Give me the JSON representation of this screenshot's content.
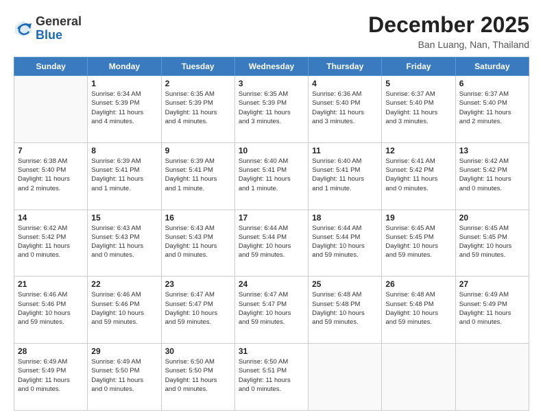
{
  "header": {
    "logo_general": "General",
    "logo_blue": "Blue",
    "month_title": "December 2025",
    "location": "Ban Luang, Nan, Thailand"
  },
  "days_of_week": [
    "Sunday",
    "Monday",
    "Tuesday",
    "Wednesday",
    "Thursday",
    "Friday",
    "Saturday"
  ],
  "weeks": [
    [
      {
        "day": "",
        "info": ""
      },
      {
        "day": "1",
        "info": "Sunrise: 6:34 AM\nSunset: 5:39 PM\nDaylight: 11 hours\nand 4 minutes."
      },
      {
        "day": "2",
        "info": "Sunrise: 6:35 AM\nSunset: 5:39 PM\nDaylight: 11 hours\nand 4 minutes."
      },
      {
        "day": "3",
        "info": "Sunrise: 6:35 AM\nSunset: 5:39 PM\nDaylight: 11 hours\nand 3 minutes."
      },
      {
        "day": "4",
        "info": "Sunrise: 6:36 AM\nSunset: 5:40 PM\nDaylight: 11 hours\nand 3 minutes."
      },
      {
        "day": "5",
        "info": "Sunrise: 6:37 AM\nSunset: 5:40 PM\nDaylight: 11 hours\nand 3 minutes."
      },
      {
        "day": "6",
        "info": "Sunrise: 6:37 AM\nSunset: 5:40 PM\nDaylight: 11 hours\nand 2 minutes."
      }
    ],
    [
      {
        "day": "7",
        "info": "Sunrise: 6:38 AM\nSunset: 5:40 PM\nDaylight: 11 hours\nand 2 minutes."
      },
      {
        "day": "8",
        "info": "Sunrise: 6:39 AM\nSunset: 5:41 PM\nDaylight: 11 hours\nand 1 minute."
      },
      {
        "day": "9",
        "info": "Sunrise: 6:39 AM\nSunset: 5:41 PM\nDaylight: 11 hours\nand 1 minute."
      },
      {
        "day": "10",
        "info": "Sunrise: 6:40 AM\nSunset: 5:41 PM\nDaylight: 11 hours\nand 1 minute."
      },
      {
        "day": "11",
        "info": "Sunrise: 6:40 AM\nSunset: 5:41 PM\nDaylight: 11 hours\nand 1 minute."
      },
      {
        "day": "12",
        "info": "Sunrise: 6:41 AM\nSunset: 5:42 PM\nDaylight: 11 hours\nand 0 minutes."
      },
      {
        "day": "13",
        "info": "Sunrise: 6:42 AM\nSunset: 5:42 PM\nDaylight: 11 hours\nand 0 minutes."
      }
    ],
    [
      {
        "day": "14",
        "info": "Sunrise: 6:42 AM\nSunset: 5:42 PM\nDaylight: 11 hours\nand 0 minutes."
      },
      {
        "day": "15",
        "info": "Sunrise: 6:43 AM\nSunset: 5:43 PM\nDaylight: 11 hours\nand 0 minutes."
      },
      {
        "day": "16",
        "info": "Sunrise: 6:43 AM\nSunset: 5:43 PM\nDaylight: 11 hours\nand 0 minutes."
      },
      {
        "day": "17",
        "info": "Sunrise: 6:44 AM\nSunset: 5:44 PM\nDaylight: 10 hours\nand 59 minutes."
      },
      {
        "day": "18",
        "info": "Sunrise: 6:44 AM\nSunset: 5:44 PM\nDaylight: 10 hours\nand 59 minutes."
      },
      {
        "day": "19",
        "info": "Sunrise: 6:45 AM\nSunset: 5:45 PM\nDaylight: 10 hours\nand 59 minutes."
      },
      {
        "day": "20",
        "info": "Sunrise: 6:45 AM\nSunset: 5:45 PM\nDaylight: 10 hours\nand 59 minutes."
      }
    ],
    [
      {
        "day": "21",
        "info": "Sunrise: 6:46 AM\nSunset: 5:46 PM\nDaylight: 10 hours\nand 59 minutes."
      },
      {
        "day": "22",
        "info": "Sunrise: 6:46 AM\nSunset: 5:46 PM\nDaylight: 10 hours\nand 59 minutes."
      },
      {
        "day": "23",
        "info": "Sunrise: 6:47 AM\nSunset: 5:47 PM\nDaylight: 10 hours\nand 59 minutes."
      },
      {
        "day": "24",
        "info": "Sunrise: 6:47 AM\nSunset: 5:47 PM\nDaylight: 10 hours\nand 59 minutes."
      },
      {
        "day": "25",
        "info": "Sunrise: 6:48 AM\nSunset: 5:48 PM\nDaylight: 10 hours\nand 59 minutes."
      },
      {
        "day": "26",
        "info": "Sunrise: 6:48 AM\nSunset: 5:48 PM\nDaylight: 10 hours\nand 59 minutes."
      },
      {
        "day": "27",
        "info": "Sunrise: 6:49 AM\nSunset: 5:49 PM\nDaylight: 11 hours\nand 0 minutes."
      }
    ],
    [
      {
        "day": "28",
        "info": "Sunrise: 6:49 AM\nSunset: 5:49 PM\nDaylight: 11 hours\nand 0 minutes."
      },
      {
        "day": "29",
        "info": "Sunrise: 6:49 AM\nSunset: 5:50 PM\nDaylight: 11 hours\nand 0 minutes."
      },
      {
        "day": "30",
        "info": "Sunrise: 6:50 AM\nSunset: 5:50 PM\nDaylight: 11 hours\nand 0 minutes."
      },
      {
        "day": "31",
        "info": "Sunrise: 6:50 AM\nSunset: 5:51 PM\nDaylight: 11 hours\nand 0 minutes."
      },
      {
        "day": "",
        "info": ""
      },
      {
        "day": "",
        "info": ""
      },
      {
        "day": "",
        "info": ""
      }
    ]
  ]
}
